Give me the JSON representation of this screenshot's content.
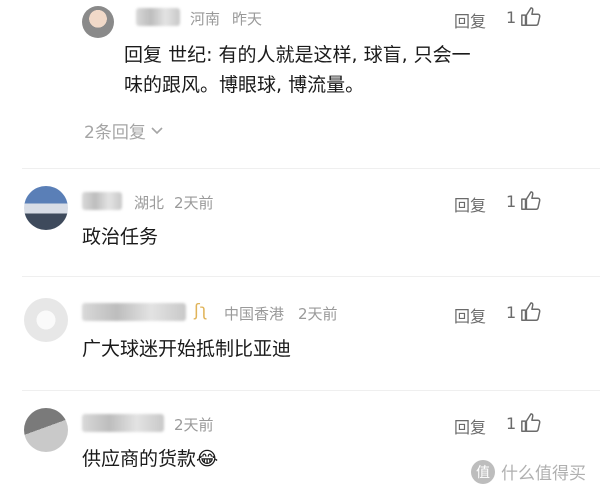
{
  "comments": [
    {
      "location": "河南",
      "time": "昨天",
      "reply_label": "回复",
      "likes": "1",
      "reply_prefix": "回复",
      "reply_to": "世纪",
      "text_line1": ": 有的人就是这样, 球盲, 只会一",
      "text_line2": "味的跟风。博眼球, 博流量。",
      "more_replies": "2条回复"
    },
    {
      "location": "湖北",
      "time": "2天前",
      "reply_label": "回复",
      "likes": "1",
      "text": "政治任务"
    },
    {
      "badge": "ʃʅ",
      "location": "中国香港",
      "time": "2天前",
      "reply_label": "回复",
      "likes": "1",
      "text": "广大球迷开始抵制比亚迪"
    },
    {
      "time": "2天前",
      "reply_label": "回复",
      "likes": "1",
      "text": "供应商的货款",
      "emoji": "😂"
    }
  ],
  "watermark": {
    "icon": "zhi-icon",
    "text": "什么值得买"
  }
}
